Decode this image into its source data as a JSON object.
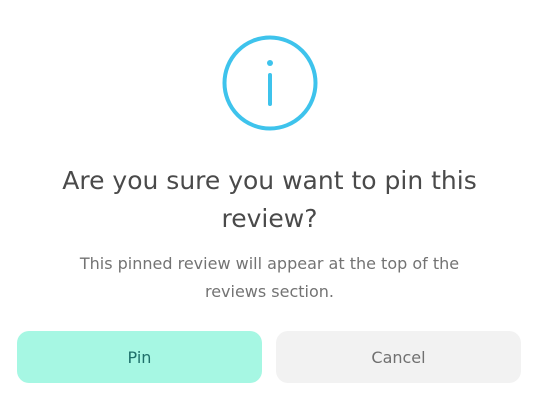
{
  "dialog": {
    "icon": "info-circle-icon",
    "accent_color": "#3ec3ec",
    "title": "Are you sure you want to pin this review?",
    "message": "This pinned review will appear at the top of the reviews section.",
    "confirm_label": "Pin",
    "cancel_label": "Cancel",
    "confirm_bg": "#a6f7e3",
    "cancel_bg": "#f2f2f2"
  }
}
